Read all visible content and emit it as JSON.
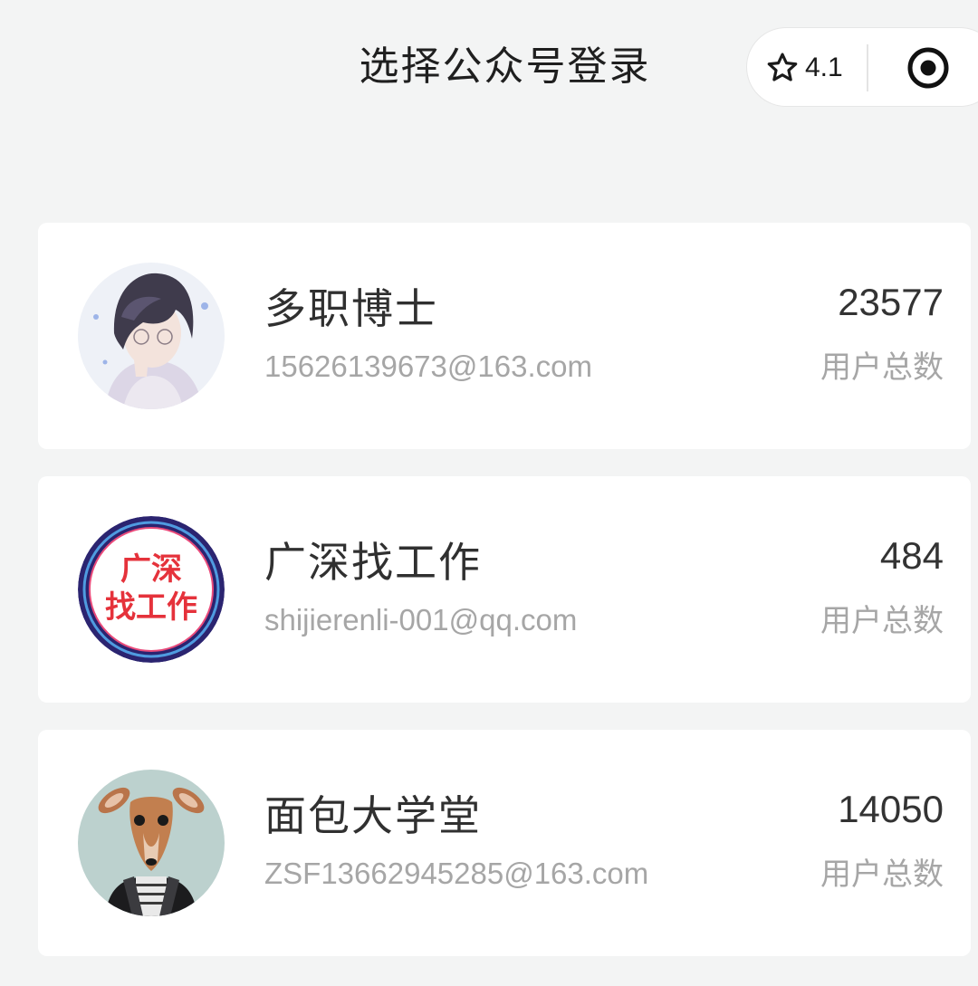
{
  "header": {
    "title": "选择公众号登录",
    "rating": "4.1",
    "favorite_icon": "star-outline-icon",
    "target_icon": "record-target-icon"
  },
  "accounts": [
    {
      "name": "多职博士",
      "email": "15626139673@163.com",
      "count": "23577",
      "count_label": "用户总数",
      "avatar": "anime-character-avatar"
    },
    {
      "name": "广深找工作",
      "email": "shijierenli-001@qq.com",
      "count": "484",
      "count_label": "用户总数",
      "avatar": "text-logo-avatar",
      "avatar_text_line1": "广深",
      "avatar_text_line2": "找工作"
    },
    {
      "name": "面包大学堂",
      "email": "ZSF13662945285@163.com",
      "count": "14050",
      "count_label": "用户总数",
      "avatar": "deer-in-jacket-avatar"
    }
  ],
  "colors": {
    "background": "#f3f4f4",
    "card": "#ffffff",
    "secondary_text": "#a6a6a6",
    "logo_red": "#e5323b",
    "logo_ring": "#2b2470"
  }
}
